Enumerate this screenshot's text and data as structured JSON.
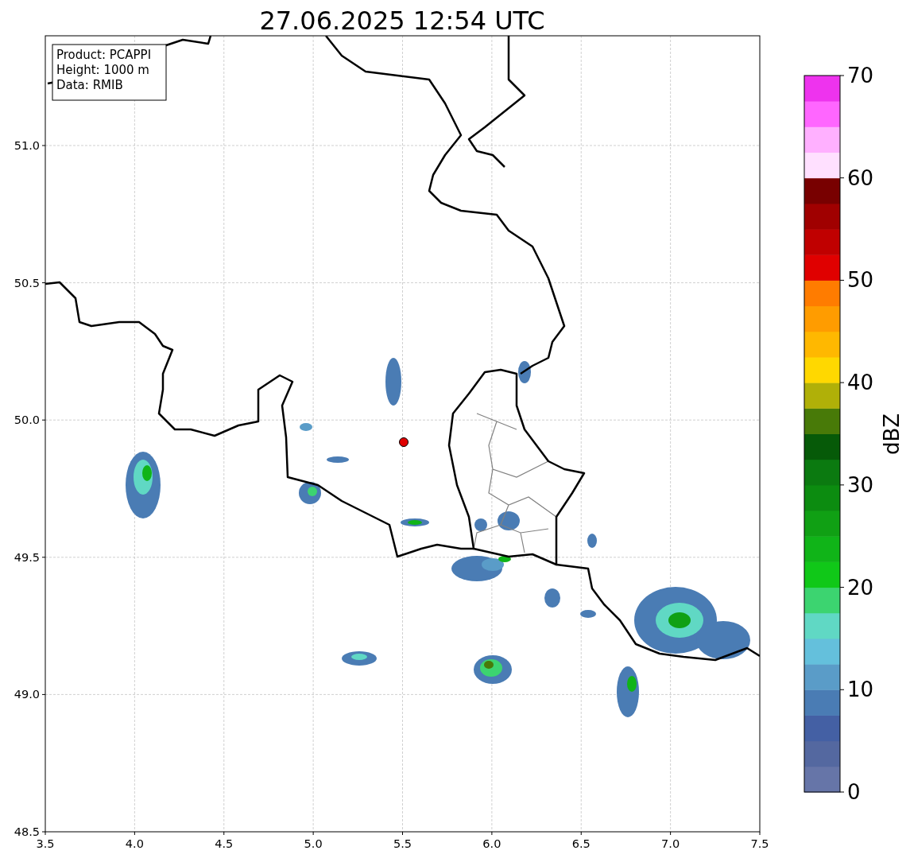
{
  "title": "27.06.2025 12:54 UTC",
  "info_box": [
    "Product: PCAPPI",
    "Height: 1000 m",
    "Data: RMIB"
  ],
  "x_ticks": [
    "3.5",
    "4.0",
    "4.5",
    "5.0",
    "5.5",
    "6.0",
    "6.5",
    "7.0",
    "7.5"
  ],
  "y_ticks": [
    "51.0",
    "50.5",
    "50.0",
    "49.5",
    "49.0",
    "48.5"
  ],
  "colorbar": {
    "label": "dBZ",
    "ticks": [
      "70",
      "60",
      "50",
      "40",
      "30",
      "20",
      "10",
      "0"
    ],
    "bands": [
      {
        "color": "#6675a8"
      },
      {
        "color": "#5468a0"
      },
      {
        "color": "#4460a4"
      },
      {
        "color": "#4a7cb4"
      },
      {
        "color": "#5a9cc8"
      },
      {
        "color": "#64c0dc"
      },
      {
        "color": "#60d8c4"
      },
      {
        "color": "#3cd470"
      },
      {
        "color": "#10c818"
      },
      {
        "color": "#10b418"
      },
      {
        "color": "#10a014"
      },
      {
        "color": "#0c8c10"
      },
      {
        "color": "#0b7a10"
      },
      {
        "color": "#065a08"
      },
      {
        "color": "#487a08"
      },
      {
        "color": "#b0b008"
      },
      {
        "color": "#ffd800"
      },
      {
        "color": "#ffb800"
      },
      {
        "color": "#ff9c00"
      },
      {
        "color": "#ff7c00"
      },
      {
        "color": "#e00000"
      },
      {
        "color": "#c00000"
      },
      {
        "color": "#a00000"
      },
      {
        "color": "#780000"
      },
      {
        "color": "#ffe0ff"
      },
      {
        "color": "#ffb0ff"
      },
      {
        "color": "#ff66ff"
      },
      {
        "color": "#ee33ee"
      }
    ]
  }
}
